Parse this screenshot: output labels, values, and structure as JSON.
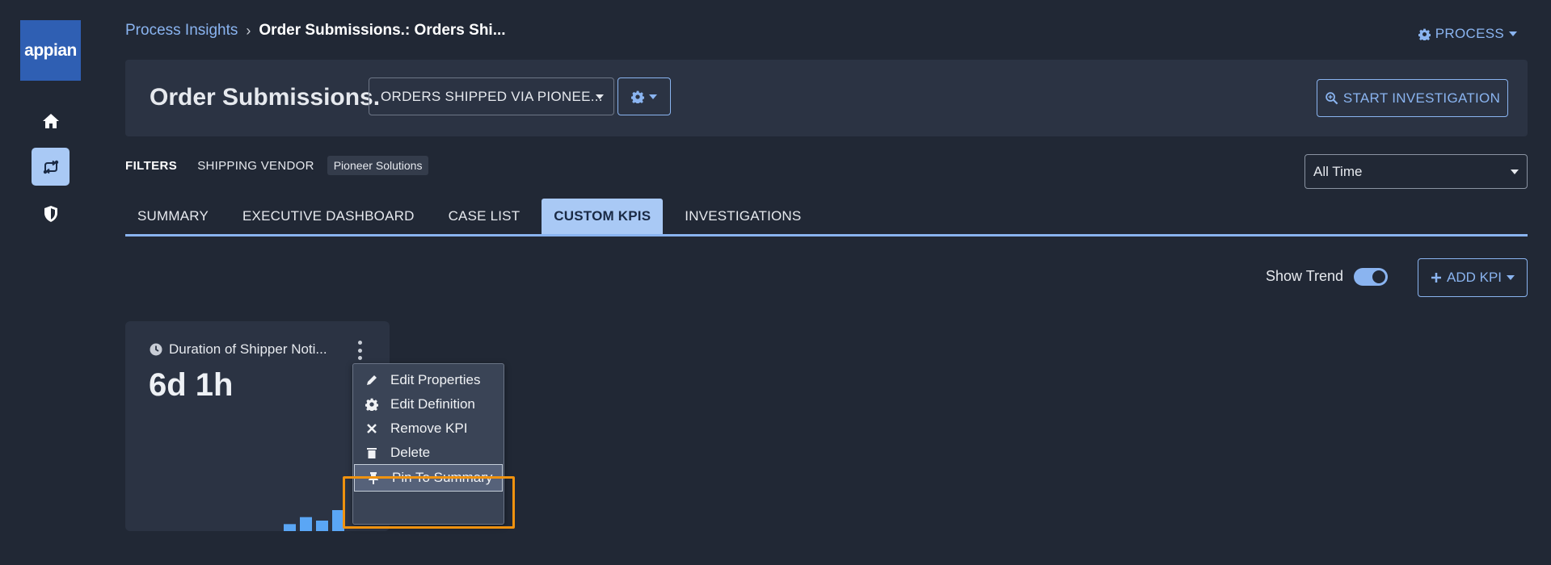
{
  "app": {
    "logo_text": "appian"
  },
  "rail": {
    "items": [
      {
        "icon": "home-icon"
      },
      {
        "icon": "process-icon",
        "active": true
      },
      {
        "icon": "shield-icon"
      }
    ]
  },
  "breadcrumb": {
    "parent": "Process Insights",
    "separator": "›",
    "current": "Order Submissions.: Orders Shi..."
  },
  "process_menu": {
    "label": "PROCESS"
  },
  "header": {
    "title": "Order Submissions.",
    "view_select": "ORDERS SHIPPED VIA PIONEE...",
    "start_investigation": "START INVESTIGATION"
  },
  "filters": {
    "label": "FILTERS",
    "key": "SHIPPING VENDOR",
    "value": "Pioneer Solutions"
  },
  "time_range": {
    "selected": "All Time"
  },
  "tabs": [
    {
      "label": "SUMMARY"
    },
    {
      "label": "EXECUTIVE DASHBOARD"
    },
    {
      "label": "CASE LIST"
    },
    {
      "label": "CUSTOM KPIS",
      "active": true
    },
    {
      "label": "INVESTIGATIONS"
    }
  ],
  "toolbar": {
    "show_trend_label": "Show Trend",
    "show_trend_on": true,
    "add_kpi_label": "ADD KPI"
  },
  "kpi_card": {
    "title": "Duration of Shipper Noti...",
    "value": "6d 1h",
    "trend_bars": [
      2,
      4,
      3,
      6
    ]
  },
  "context_menu": {
    "items": [
      {
        "label": "Edit Properties",
        "icon": "pencil-icon"
      },
      {
        "label": "Edit Definition",
        "icon": "gear-icon"
      },
      {
        "label": "Remove KPI",
        "icon": "x-icon"
      },
      {
        "label": "Delete",
        "icon": "trash-icon"
      },
      {
        "label": "Pin To Summary",
        "icon": "pin-icon",
        "highlighted": true
      }
    ]
  },
  "colors": {
    "background": "#212835",
    "panel": "#2b3343",
    "accent": "#8ab4f0",
    "active_tab": "#a9c9f5",
    "highlight_box": "#f0920f",
    "logo": "#2f5fb3"
  }
}
